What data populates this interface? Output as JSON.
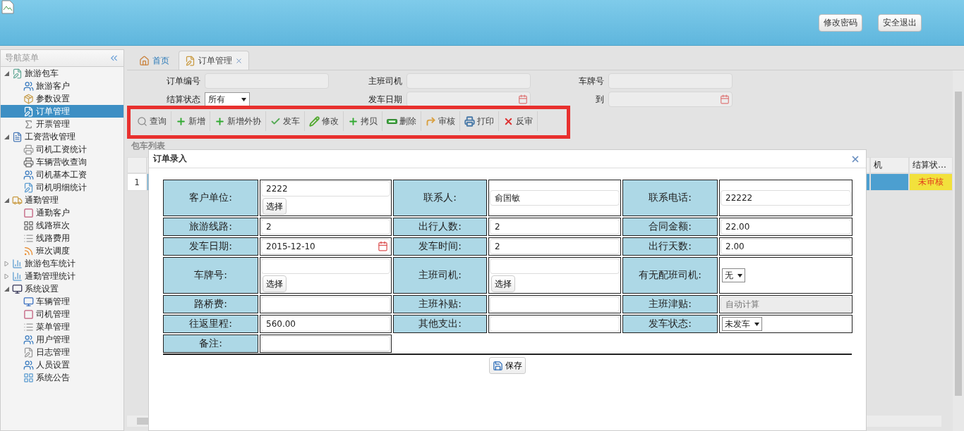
{
  "header": {
    "buttons": [
      "修改密码",
      "安全退出"
    ]
  },
  "nav": {
    "title": "导航菜单",
    "items": [
      {
        "label": "旅游包车",
        "expanded": true,
        "selected": false,
        "children": [
          {
            "label": "旅游客户",
            "selected": false
          },
          {
            "label": "参数设置",
            "selected": false
          },
          {
            "label": "订单管理",
            "selected": true
          },
          {
            "label": "开票管理",
            "selected": false
          }
        ]
      },
      {
        "label": "工资营收管理",
        "expanded": true,
        "selected": false,
        "children": [
          {
            "label": "司机工资统计",
            "selected": false
          },
          {
            "label": "车辆营收查询",
            "selected": false
          },
          {
            "label": "司机基本工资",
            "selected": false
          },
          {
            "label": "司机明细统计",
            "selected": false
          }
        ]
      },
      {
        "label": "通勤管理",
        "expanded": true,
        "selected": false,
        "children": [
          {
            "label": "通勤客户",
            "selected": false
          },
          {
            "label": "线路班次",
            "selected": false
          },
          {
            "label": "线路费用",
            "selected": false
          },
          {
            "label": "班次调度",
            "selected": false
          }
        ]
      },
      {
        "label": "旅游包车统计",
        "expanded": false,
        "selected": false
      },
      {
        "label": "通勤管理统计",
        "expanded": false,
        "selected": false
      },
      {
        "label": "系统设置",
        "expanded": true,
        "selected": false,
        "children": [
          {
            "label": "车辆管理",
            "selected": false
          },
          {
            "label": "司机管理",
            "selected": false
          },
          {
            "label": "菜单管理",
            "selected": false
          },
          {
            "label": "用户管理",
            "selected": false
          },
          {
            "label": "日志管理",
            "selected": false
          },
          {
            "label": "人员设置",
            "selected": false
          },
          {
            "label": "系统公告",
            "selected": false
          }
        ]
      }
    ]
  },
  "tabs": [
    {
      "label": "首页",
      "selected": false,
      "closable": false
    },
    {
      "label": "订单管理",
      "selected": true,
      "closable": true
    }
  ],
  "search": [
    [
      {
        "label": "订单编号",
        "kind": "text"
      },
      {
        "label": "主班司机",
        "kind": "text"
      },
      {
        "label": "车牌号",
        "kind": "text"
      }
    ],
    [
      {
        "label": "结算状态",
        "kind": "select",
        "value": "所有"
      },
      {
        "label": "发车日期",
        "kind": "date"
      },
      {
        "label": "到",
        "kind": "date"
      }
    ]
  ],
  "toolbar": [
    "查询",
    "新增",
    "新增外协",
    "发车",
    "修改",
    "拷贝",
    "删除",
    "审核",
    "打印",
    "反审"
  ],
  "grid": {
    "title": "包车列表",
    "columns": [
      {
        "label": "机"
      },
      {
        "label": "结算状…"
      }
    ],
    "rows": [
      {
        "number": "1",
        "selected": true,
        "cells": [
          {
            "kind": "plain"
          },
          {
            "text": "未审核",
            "kind": "status"
          }
        ]
      }
    ]
  },
  "dialog": {
    "title": "订单录入",
    "save": "保存",
    "rows": [
      [
        {
          "label": "客户单位:",
          "kind": "picker",
          "value": "2222",
          "button": "选择"
        },
        {
          "label": "联系人:",
          "kind": "text",
          "value": "俞国敏"
        },
        {
          "label": "联系电话:",
          "kind": "text",
          "value": "22222"
        }
      ],
      [
        {
          "label": "旅游线路:",
          "kind": "text",
          "value": "2"
        },
        {
          "label": "出行人数:",
          "kind": "text",
          "value": "2"
        },
        {
          "label": "合同金额:",
          "kind": "text",
          "value": "22.00"
        }
      ],
      [
        {
          "label": "发车日期:",
          "kind": "date",
          "value": "2015-12-10"
        },
        {
          "label": "发车时间:",
          "kind": "text",
          "value": "2"
        },
        {
          "label": "出行天数:",
          "kind": "text",
          "value": "2.00"
        }
      ],
      [
        {
          "label": "车牌号:",
          "kind": "picker",
          "button": "选择"
        },
        {
          "label": "主班司机:",
          "kind": "picker",
          "button": "选择"
        },
        {
          "label": "有无配班司机:",
          "kind": "select",
          "value": "无"
        }
      ],
      [
        {
          "label": "路桥费:",
          "kind": "text"
        },
        {
          "label": "主班补贴:",
          "kind": "text"
        },
        {
          "label": "主班津贴:",
          "kind": "readonly",
          "placeholder": "自动计算"
        }
      ],
      [
        {
          "label": "往返里程:",
          "kind": "text",
          "value": "560.00"
        },
        {
          "label": "其他支出:",
          "kind": "text"
        },
        {
          "label": "发车状态:",
          "kind": "select",
          "value": "未发车"
        }
      ],
      [
        {
          "label": "备注:",
          "kind": "text"
        }
      ]
    ]
  }
}
